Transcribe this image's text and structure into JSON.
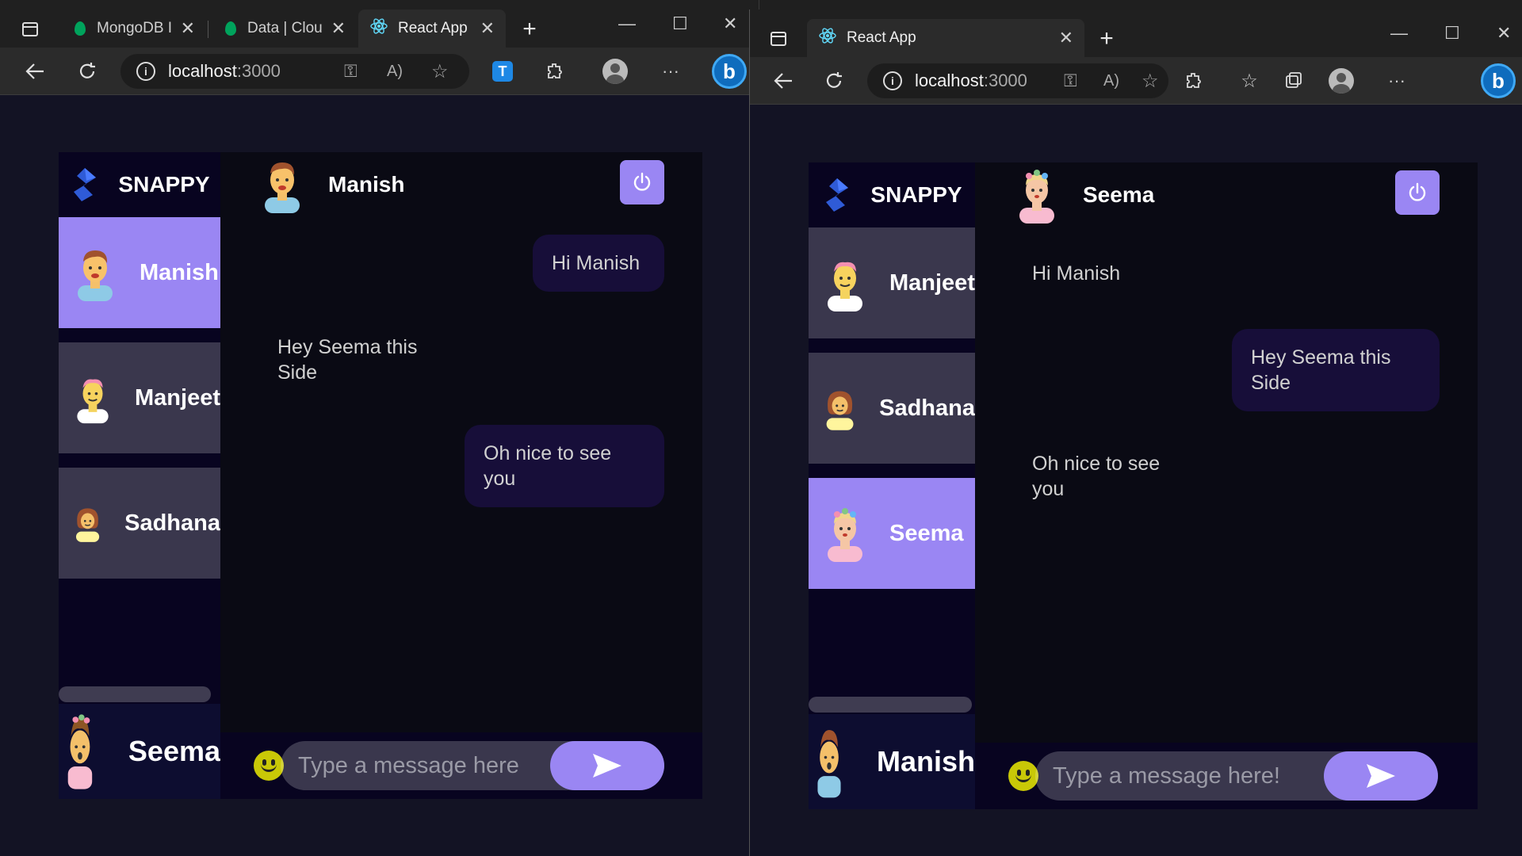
{
  "window_left": {
    "tabs": [
      {
        "label": "MongoDB I"
      },
      {
        "label": "Data | Clou"
      },
      {
        "label": "React App"
      }
    ],
    "url_host": "localhost",
    "url_port": ":3000",
    "app": {
      "brand": "SNAPPY",
      "contacts": [
        {
          "name": "Manish",
          "selected": true
        },
        {
          "name": "Manjeet",
          "selected": false
        },
        {
          "name": "Sadhana",
          "selected": false
        }
      ],
      "current_user": "Seema",
      "chat_header_name": "Manish",
      "messages": [
        {
          "text": "Hi Manish",
          "direction": "sent"
        },
        {
          "text": "Hey Seema this Side",
          "direction": "received"
        },
        {
          "text": "Oh nice to see you",
          "direction": "sent"
        }
      ],
      "input_placeholder": "Type a message here"
    }
  },
  "window_right": {
    "tabs": [
      {
        "label": "React App"
      }
    ],
    "url_host": "localhost",
    "url_port": ":3000",
    "app": {
      "brand": "SNAPPY",
      "contacts": [
        {
          "name": "Manjeet",
          "selected": false
        },
        {
          "name": "Sadhana",
          "selected": false
        },
        {
          "name": "Seema",
          "selected": true
        }
      ],
      "current_user": "Manish",
      "chat_header_name": "Seema",
      "messages": [
        {
          "text": "Hi Manish",
          "direction": "received"
        },
        {
          "text": "Hey Seema this Side",
          "direction": "sent"
        },
        {
          "text": "Oh nice to see you",
          "direction": "received"
        }
      ],
      "input_placeholder": "Type a message here!"
    }
  },
  "colors": {
    "accent": "#9a86f3",
    "page_bg": "#131324",
    "sent_bubble": "#170e39"
  }
}
